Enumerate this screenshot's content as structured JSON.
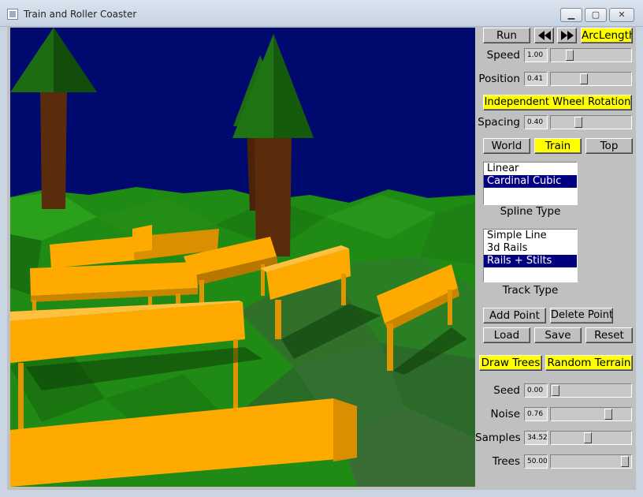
{
  "window": {
    "title": "Train and Roller Coaster",
    "minimize": "▁",
    "maximize": "▢",
    "close": "✕"
  },
  "playback": {
    "run_label": "Run",
    "rewind_icon": "rewind-icon",
    "fastforward_icon": "fast-forward-icon",
    "arclength_label": "ArcLength",
    "arclength_on": true
  },
  "sliders": {
    "speed": {
      "label": "Speed",
      "value": "1.00",
      "fraction": 0.2
    },
    "position": {
      "label": "Position",
      "value": "0.41",
      "fraction": 0.41
    },
    "spacing": {
      "label": "Spacing",
      "value": "0.40",
      "fraction": 0.33
    },
    "seed": {
      "label": "Seed",
      "value": "0.00",
      "fraction": 0.0
    },
    "noise": {
      "label": "Noise",
      "value": "0.76",
      "fraction": 0.76
    },
    "samples": {
      "label": "Samples",
      "value": "34.52",
      "fraction": 0.47
    },
    "trees": {
      "label": "Trees",
      "value": "50.00",
      "fraction": 1.0
    }
  },
  "independent_wheel_label": "Independent Wheel Rotation",
  "views": {
    "world": "World",
    "train": "Train",
    "top": "Top",
    "active": "train"
  },
  "spline": {
    "items": [
      "Linear",
      "Cardinal Cubic"
    ],
    "selected": 1,
    "caption": "Spline Type"
  },
  "track": {
    "items": [
      "Simple Line",
      "3d Rails",
      "Rails + Stilts"
    ],
    "selected": 2,
    "caption": "Track Type"
  },
  "actions": {
    "add_point": "Add Point",
    "delete_point": "Delete Point",
    "load": "Load",
    "save": "Save",
    "reset": "Reset"
  },
  "terrain": {
    "draw_trees": "Draw Trees",
    "random_terrain": "Random Terrain"
  },
  "colors": {
    "sky": "#000a6e",
    "terrain": "#1f8a14",
    "rail": "#ffaa00",
    "tree_leaves": "#1d6b12",
    "trunk": "#5a2c0c",
    "toggle_on": "#ffff00",
    "selection": "#000080"
  }
}
